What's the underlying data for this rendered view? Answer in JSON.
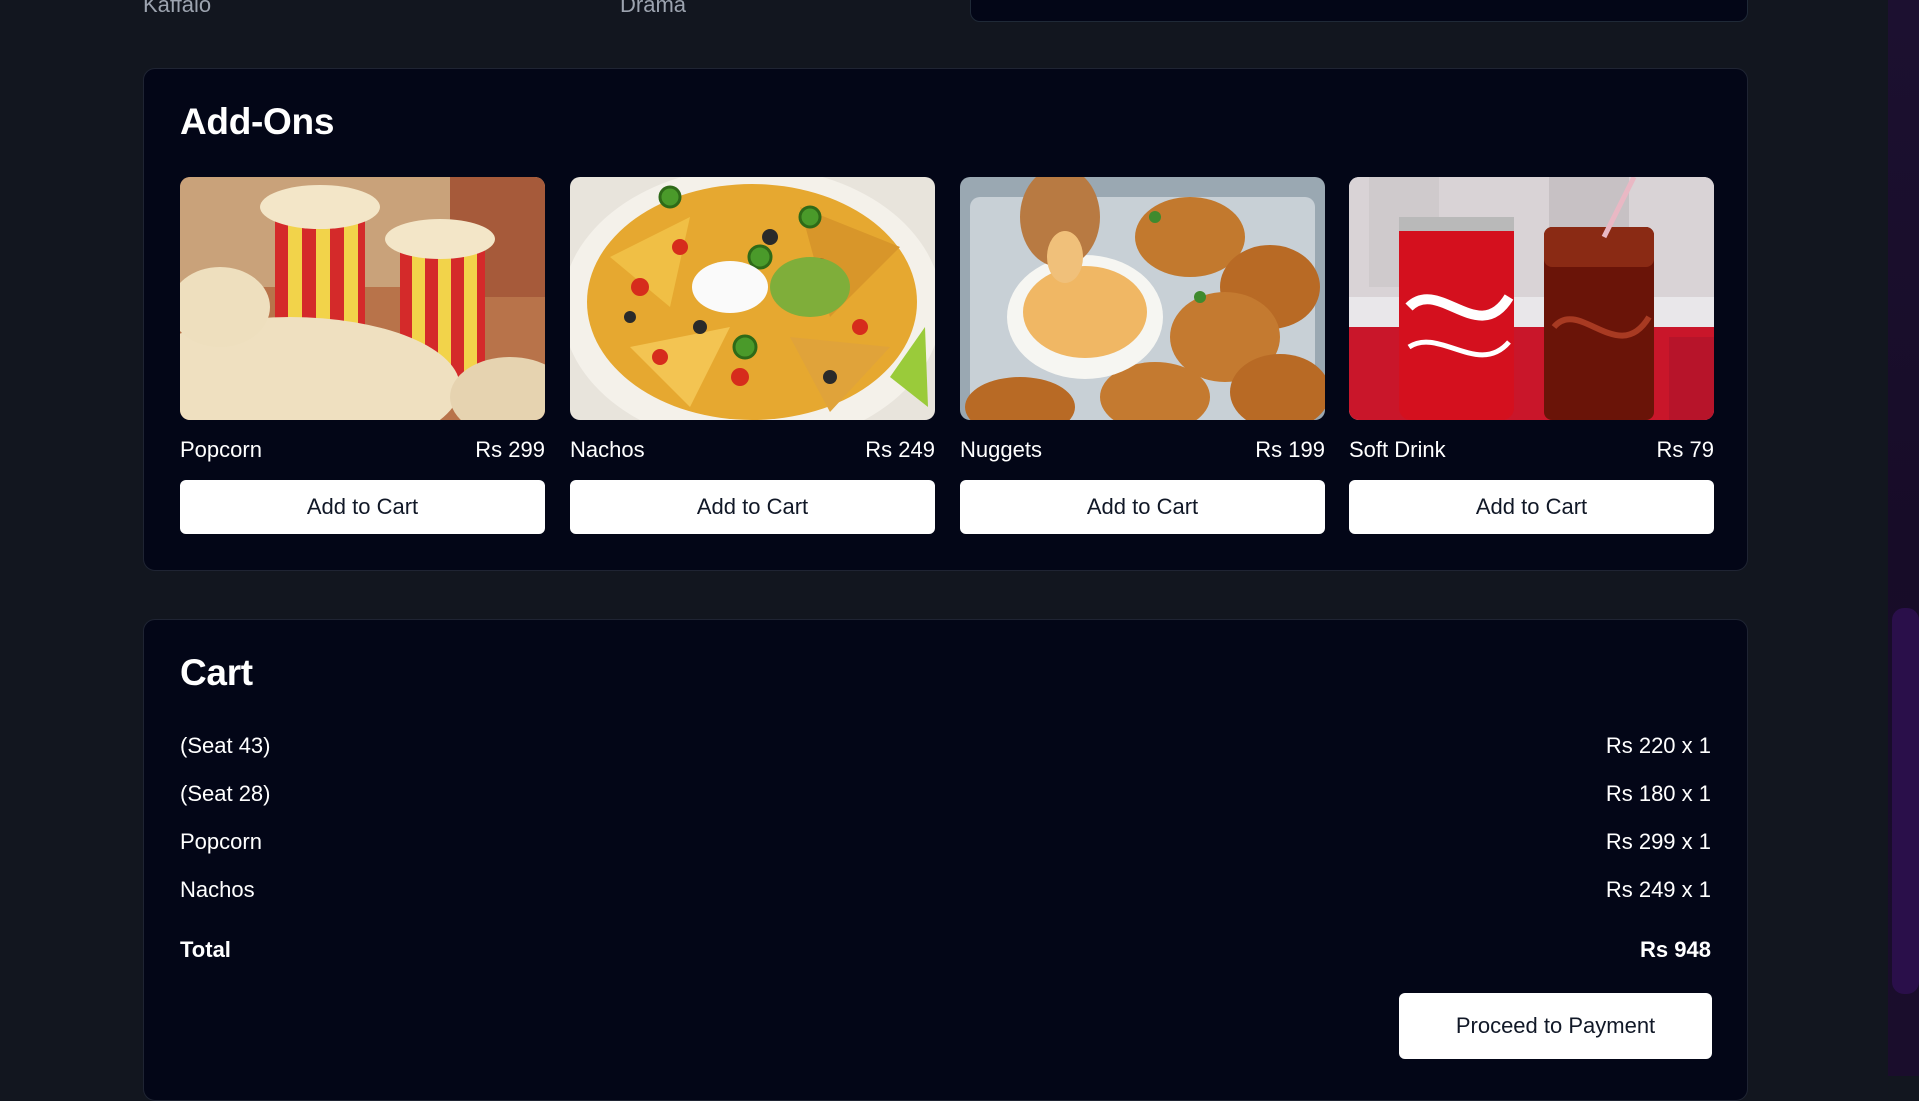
{
  "top": {
    "left_label": "Kaffalo",
    "right_label": "Drama"
  },
  "addons": {
    "title": "Add-Ons",
    "items": [
      {
        "name": "Popcorn",
        "price": "Rs 299",
        "button": "Add to Cart"
      },
      {
        "name": "Nachos",
        "price": "Rs 249",
        "button": "Add to Cart"
      },
      {
        "name": "Nuggets",
        "price": "Rs 199",
        "button": "Add to Cart"
      },
      {
        "name": "Soft Drink",
        "price": "Rs 79",
        "button": "Add to Cart"
      }
    ]
  },
  "cart": {
    "title": "Cart",
    "lines": [
      {
        "label": "(Seat 43)",
        "amount": "Rs 220 x 1"
      },
      {
        "label": "(Seat 28)",
        "amount": "Rs 180 x 1"
      },
      {
        "label": "Popcorn",
        "amount": "Rs 299 x 1"
      },
      {
        "label": "Nachos",
        "amount": "Rs 249 x 1"
      }
    ],
    "total_label": "Total",
    "total_amount": "Rs 948",
    "pay_button": "Proceed to Payment"
  }
}
